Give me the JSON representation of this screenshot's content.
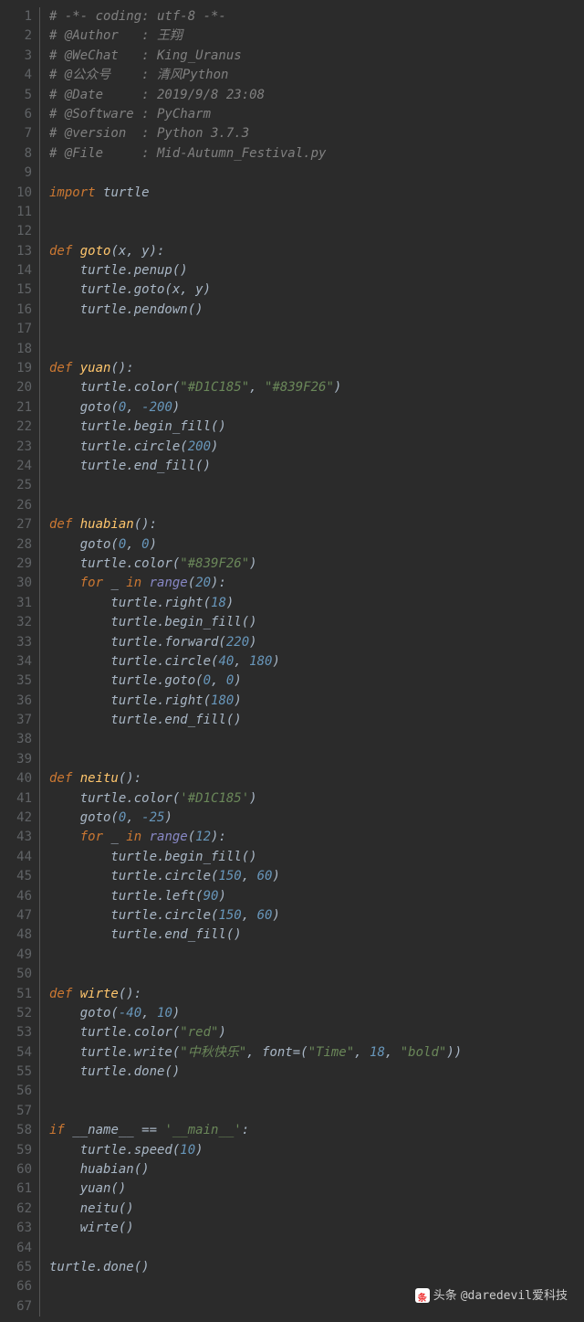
{
  "watermark": {
    "prefix": "头条",
    "handle": "@daredevil爱科技"
  },
  "lines": [
    {
      "n": 1,
      "t": [
        [
          "cm",
          "# -*- coding: utf-8 -*-"
        ]
      ]
    },
    {
      "n": 2,
      "t": [
        [
          "cm",
          "# @Author   : 王翔"
        ]
      ]
    },
    {
      "n": 3,
      "t": [
        [
          "cm",
          "# @WeChat   : King_Uranus"
        ]
      ]
    },
    {
      "n": 4,
      "t": [
        [
          "cm",
          "# @公众号    : 清风Python"
        ]
      ]
    },
    {
      "n": 5,
      "t": [
        [
          "cm",
          "# @Date     : 2019/9/8 23:08"
        ]
      ]
    },
    {
      "n": 6,
      "t": [
        [
          "cm",
          "# @Software : PyCharm"
        ]
      ]
    },
    {
      "n": 7,
      "t": [
        [
          "cm",
          "# @version  : Python 3.7.3"
        ]
      ]
    },
    {
      "n": 8,
      "t": [
        [
          "cm",
          "# @File     : Mid-Autumn_Festival.py"
        ]
      ]
    },
    {
      "n": 9,
      "t": []
    },
    {
      "n": 10,
      "t": [
        [
          "kw",
          "import "
        ],
        [
          "p",
          "turtle"
        ]
      ]
    },
    {
      "n": 11,
      "t": []
    },
    {
      "n": 12,
      "t": []
    },
    {
      "n": 13,
      "t": [
        [
          "kw",
          "def "
        ],
        [
          "fn",
          "goto"
        ],
        [
          "p",
          "(x"
        ],
        [
          "op",
          ", "
        ],
        [
          "p",
          "y):"
        ]
      ]
    },
    {
      "n": 14,
      "t": [
        [
          "p",
          "    turtle.penup()"
        ]
      ]
    },
    {
      "n": 15,
      "t": [
        [
          "p",
          "    turtle.goto(x"
        ],
        [
          "op",
          ", "
        ],
        [
          "p",
          "y)"
        ]
      ]
    },
    {
      "n": 16,
      "t": [
        [
          "p",
          "    turtle.pendown()"
        ]
      ]
    },
    {
      "n": 17,
      "t": []
    },
    {
      "n": 18,
      "t": []
    },
    {
      "n": 19,
      "t": [
        [
          "kw",
          "def "
        ],
        [
          "fn",
          "yuan"
        ],
        [
          "p",
          "():"
        ]
      ]
    },
    {
      "n": 20,
      "t": [
        [
          "p",
          "    turtle.color("
        ],
        [
          "str",
          "\"#D1C185\""
        ],
        [
          "op",
          ", "
        ],
        [
          "str",
          "\"#839F26\""
        ],
        [
          "p",
          ")"
        ]
      ]
    },
    {
      "n": 21,
      "t": [
        [
          "p",
          "    goto("
        ],
        [
          "num",
          "0"
        ],
        [
          "op",
          ", "
        ],
        [
          "num",
          "-200"
        ],
        [
          "p",
          ")"
        ]
      ]
    },
    {
      "n": 22,
      "t": [
        [
          "p",
          "    turtle.begin_fill()"
        ]
      ]
    },
    {
      "n": 23,
      "t": [
        [
          "p",
          "    turtle.circle("
        ],
        [
          "num",
          "200"
        ],
        [
          "p",
          ")"
        ]
      ]
    },
    {
      "n": 24,
      "t": [
        [
          "p",
          "    turtle.end_fill()"
        ]
      ]
    },
    {
      "n": 25,
      "t": []
    },
    {
      "n": 26,
      "t": []
    },
    {
      "n": 27,
      "t": [
        [
          "kw",
          "def "
        ],
        [
          "fn",
          "huabian"
        ],
        [
          "p",
          "():"
        ]
      ]
    },
    {
      "n": 28,
      "t": [
        [
          "p",
          "    goto("
        ],
        [
          "num",
          "0"
        ],
        [
          "op",
          ", "
        ],
        [
          "num",
          "0"
        ],
        [
          "p",
          ")"
        ]
      ]
    },
    {
      "n": 29,
      "t": [
        [
          "p",
          "    turtle.color("
        ],
        [
          "str",
          "\"#839F26\""
        ],
        [
          "p",
          ")"
        ]
      ]
    },
    {
      "n": 30,
      "t": [
        [
          "p",
          "    "
        ],
        [
          "kw",
          "for "
        ],
        [
          "p",
          "_ "
        ],
        [
          "kw",
          "in "
        ],
        [
          "bi",
          "range"
        ],
        [
          "p",
          "("
        ],
        [
          "num",
          "20"
        ],
        [
          "p",
          "):"
        ]
      ]
    },
    {
      "n": 31,
      "t": [
        [
          "p",
          "        turtle.right("
        ],
        [
          "num",
          "18"
        ],
        [
          "p",
          ")"
        ]
      ]
    },
    {
      "n": 32,
      "t": [
        [
          "p",
          "        turtle.begin_fill()"
        ]
      ]
    },
    {
      "n": 33,
      "t": [
        [
          "p",
          "        turtle.forward("
        ],
        [
          "num",
          "220"
        ],
        [
          "p",
          ")"
        ]
      ]
    },
    {
      "n": 34,
      "t": [
        [
          "p",
          "        turtle.circle("
        ],
        [
          "num",
          "40"
        ],
        [
          "op",
          ", "
        ],
        [
          "num",
          "180"
        ],
        [
          "p",
          ")"
        ]
      ]
    },
    {
      "n": 35,
      "t": [
        [
          "p",
          "        turtle.goto("
        ],
        [
          "num",
          "0"
        ],
        [
          "op",
          ", "
        ],
        [
          "num",
          "0"
        ],
        [
          "p",
          ")"
        ]
      ]
    },
    {
      "n": 36,
      "t": [
        [
          "p",
          "        turtle.right("
        ],
        [
          "num",
          "180"
        ],
        [
          "p",
          ")"
        ]
      ]
    },
    {
      "n": 37,
      "t": [
        [
          "p",
          "        turtle.end_fill()"
        ]
      ]
    },
    {
      "n": 38,
      "t": []
    },
    {
      "n": 39,
      "t": []
    },
    {
      "n": 40,
      "t": [
        [
          "kw",
          "def "
        ],
        [
          "fn",
          "neitu"
        ],
        [
          "p",
          "():"
        ]
      ]
    },
    {
      "n": 41,
      "t": [
        [
          "p",
          "    turtle.color("
        ],
        [
          "str",
          "'#D1C185'"
        ],
        [
          "p",
          ")"
        ]
      ]
    },
    {
      "n": 42,
      "t": [
        [
          "p",
          "    goto("
        ],
        [
          "num",
          "0"
        ],
        [
          "op",
          ", "
        ],
        [
          "num",
          "-25"
        ],
        [
          "p",
          ")"
        ]
      ]
    },
    {
      "n": 43,
      "t": [
        [
          "p",
          "    "
        ],
        [
          "kw",
          "for "
        ],
        [
          "p",
          "_ "
        ],
        [
          "kw",
          "in "
        ],
        [
          "bi",
          "range"
        ],
        [
          "p",
          "("
        ],
        [
          "num",
          "12"
        ],
        [
          "p",
          "):"
        ]
      ]
    },
    {
      "n": 44,
      "t": [
        [
          "p",
          "        turtle.begin_fill()"
        ]
      ]
    },
    {
      "n": 45,
      "t": [
        [
          "p",
          "        turtle.circle("
        ],
        [
          "num",
          "150"
        ],
        [
          "op",
          ", "
        ],
        [
          "num",
          "60"
        ],
        [
          "p",
          ")"
        ]
      ]
    },
    {
      "n": 46,
      "t": [
        [
          "p",
          "        turtle.left("
        ],
        [
          "num",
          "90"
        ],
        [
          "p",
          ")"
        ]
      ]
    },
    {
      "n": 47,
      "t": [
        [
          "p",
          "        turtle.circle("
        ],
        [
          "num",
          "150"
        ],
        [
          "op",
          ", "
        ],
        [
          "num",
          "60"
        ],
        [
          "p",
          ")"
        ]
      ]
    },
    {
      "n": 48,
      "t": [
        [
          "p",
          "        turtle.end_fill()"
        ]
      ]
    },
    {
      "n": 49,
      "t": []
    },
    {
      "n": 50,
      "t": []
    },
    {
      "n": 51,
      "t": [
        [
          "kw",
          "def "
        ],
        [
          "fn",
          "wirte"
        ],
        [
          "p",
          "():"
        ]
      ]
    },
    {
      "n": 52,
      "t": [
        [
          "p",
          "    goto("
        ],
        [
          "num",
          "-40"
        ],
        [
          "op",
          ", "
        ],
        [
          "num",
          "10"
        ],
        [
          "p",
          ")"
        ]
      ]
    },
    {
      "n": 53,
      "t": [
        [
          "p",
          "    turtle.color("
        ],
        [
          "str",
          "\"red\""
        ],
        [
          "p",
          ")"
        ]
      ]
    },
    {
      "n": 54,
      "t": [
        [
          "p",
          "    turtle.write("
        ],
        [
          "str",
          "\"中秋快乐\""
        ],
        [
          "op",
          ", "
        ],
        [
          "p",
          "font=("
        ],
        [
          "str",
          "\"Time\""
        ],
        [
          "op",
          ", "
        ],
        [
          "num",
          "18"
        ],
        [
          "op",
          ", "
        ],
        [
          "str",
          "\"bold\""
        ],
        [
          "p",
          "))"
        ]
      ]
    },
    {
      "n": 55,
      "t": [
        [
          "p",
          "    turtle.done()"
        ]
      ]
    },
    {
      "n": 56,
      "t": []
    },
    {
      "n": 57,
      "t": []
    },
    {
      "n": 58,
      "t": [
        [
          "kw",
          "if "
        ],
        [
          "p",
          "__name__ == "
        ],
        [
          "str",
          "'__main__'"
        ],
        [
          "p",
          ":"
        ]
      ]
    },
    {
      "n": 59,
      "t": [
        [
          "p",
          "    turtle.speed("
        ],
        [
          "num",
          "10"
        ],
        [
          "p",
          ")"
        ]
      ]
    },
    {
      "n": 60,
      "t": [
        [
          "p",
          "    huabian()"
        ]
      ]
    },
    {
      "n": 61,
      "t": [
        [
          "p",
          "    yuan()"
        ]
      ]
    },
    {
      "n": 62,
      "t": [
        [
          "p",
          "    neitu()"
        ]
      ]
    },
    {
      "n": 63,
      "t": [
        [
          "p",
          "    wirte()"
        ]
      ]
    },
    {
      "n": 64,
      "t": []
    },
    {
      "n": 65,
      "t": [
        [
          "p",
          "turtle.done()"
        ]
      ]
    },
    {
      "n": 66,
      "t": []
    },
    {
      "n": 67,
      "t": []
    }
  ]
}
